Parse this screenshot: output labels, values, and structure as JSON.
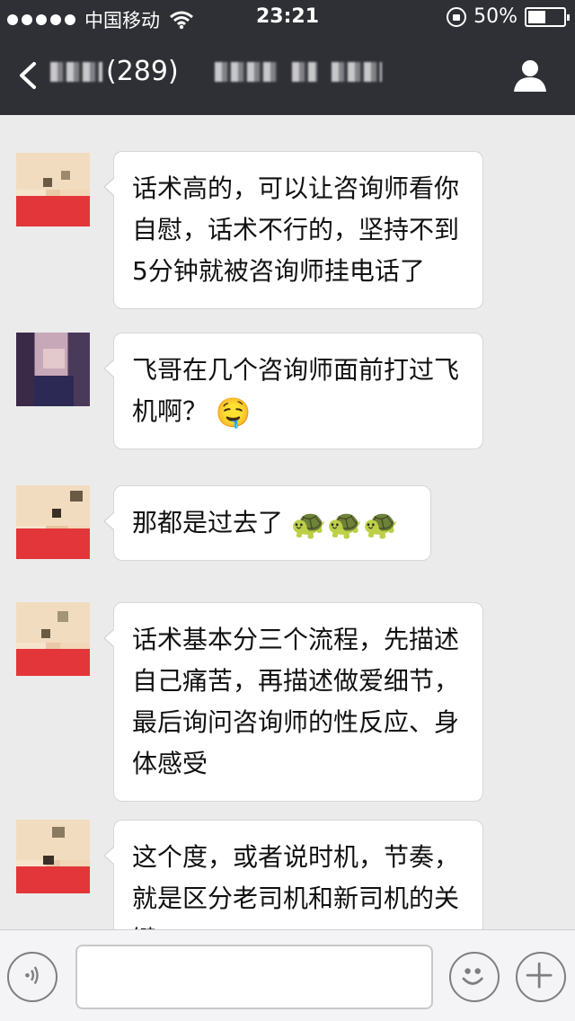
{
  "status_bar": {
    "carrier": "中国移动",
    "time": "23:21",
    "battery": "50%",
    "battery_level": 0.5
  },
  "nav": {
    "title_visible": "(289)"
  },
  "messages": [
    {
      "text": "话术高的，可以让咨询师看你自慰，话术不行的，坚持不到5分钟就被咨询师挂电话了"
    },
    {
      "text": "飞哥在几个咨询师面前打过飞机啊？",
      "emoji": "🤤"
    },
    {
      "text": "那都是过去了",
      "emoji": "🐢🐢🐢"
    },
    {
      "text": "话术基本分三个流程，先描述自己痛苦，再描述做爱细节，最后询问咨询师的性反应、身体感受"
    },
    {
      "text": "这个度，或者说时机，节奏，就是区分老司机和新司机的关键"
    }
  ],
  "input": {
    "placeholder": ""
  },
  "colors": {
    "header_bg": "#2f3035",
    "chat_bg": "#ebebeb",
    "bubble_bg": "#ffffff"
  },
  "icons": [
    "signal-dots-icon",
    "wifi-icon",
    "rotation-lock-icon",
    "battery-icon",
    "back-icon",
    "profile-icon",
    "voice-icon",
    "emoji-icon",
    "plus-icon"
  ]
}
